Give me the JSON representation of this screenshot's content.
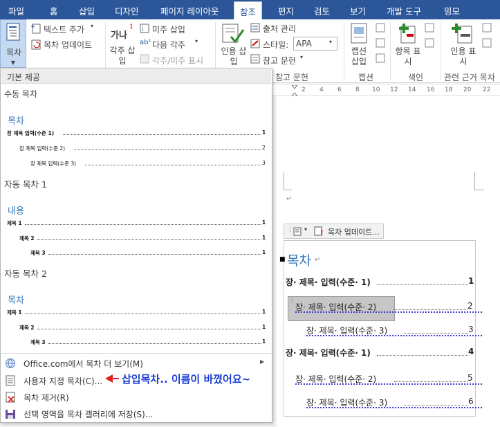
{
  "tabs": [
    "파일",
    "홈",
    "삽입",
    "디자인",
    "페이지 레이아웃",
    "참조",
    "편지",
    "검토",
    "보기",
    "개발 도구",
    "밍모"
  ],
  "ribbon": {
    "toc_btn": "목차",
    "add_text": "텍스트 추가",
    "update_toc": "목차 업데이트",
    "insert_footnote": "각주 삽입",
    "footnote_glyph": "가나",
    "insert_endnote": "미주 삽입",
    "next_footnote": "다음 각주",
    "show_notes": "각주/미주 표시",
    "insert_citation": "인용 삽입",
    "manage_sources": "출처 관리",
    "style_label": "스타일:",
    "style_value": "APA",
    "bibliography": "참고 문헌",
    "group_citations": "참고 문헌",
    "insert_caption": "캡션 삽입",
    "group_captions": "캡션",
    "mark_entry": "항목 표시",
    "group_index": "색인",
    "mark_citation": "인용 표시",
    "group_toa": "관련 근거 목차"
  },
  "ruler_numbers": [
    "2",
    "4",
    "6",
    "8",
    "10",
    "12",
    "14",
    "16",
    "18",
    "20",
    "22"
  ],
  "dropdown": {
    "header": "기본 제공",
    "manual": "수동 목차",
    "manual_title": "목차",
    "manual_rows": [
      "장 제목 입력(수준 1)",
      "장 제목 입력(수준 2)",
      "장 제목 입력(수준 3)"
    ],
    "manual_nums": [
      "1",
      "2",
      "3"
    ],
    "auto1": "자동 목차 1",
    "auto1_title": "내용",
    "auto1_rows": [
      "제목 1",
      "제목 2",
      "제목 3"
    ],
    "auto1_nums": [
      "1",
      "1",
      "1"
    ],
    "auto2": "자동 목차 2",
    "auto2_title": "목차",
    "auto2_rows": [
      "제목 1",
      "제목 2",
      "제목 3"
    ],
    "auto2_nums": [
      "1",
      "1",
      "1"
    ],
    "menu": [
      "Office.com에서 목차 더 보기(M)",
      "사용자 지정 목차(C)...",
      "목차 제거(R)",
      "선택 영역을 목차 갤러리에 저장(S)..."
    ]
  },
  "annotation": "삽입목차.. 이름이 바꼈어요~",
  "document": {
    "toolbar_update": "목차 업데이트...",
    "toc_title": "목차",
    "rows": [
      "장· 제목· 입력(수준· 1)",
      "장· 제목· 입력(수준· 2)",
      "장· 제목· 입력(수준· 3)",
      "장· 제목· 입력(수준· 1)",
      "장· 제목· 입력(수준· 2)",
      "장· 제목· 입력(수준· 3)"
    ],
    "nums": [
      "1",
      "2",
      "3",
      "4",
      "5",
      "6"
    ]
  },
  "colors": {
    "accent": "#2b579a",
    "heading": "#2e74b5",
    "annotation": "#1a3cd4"
  }
}
